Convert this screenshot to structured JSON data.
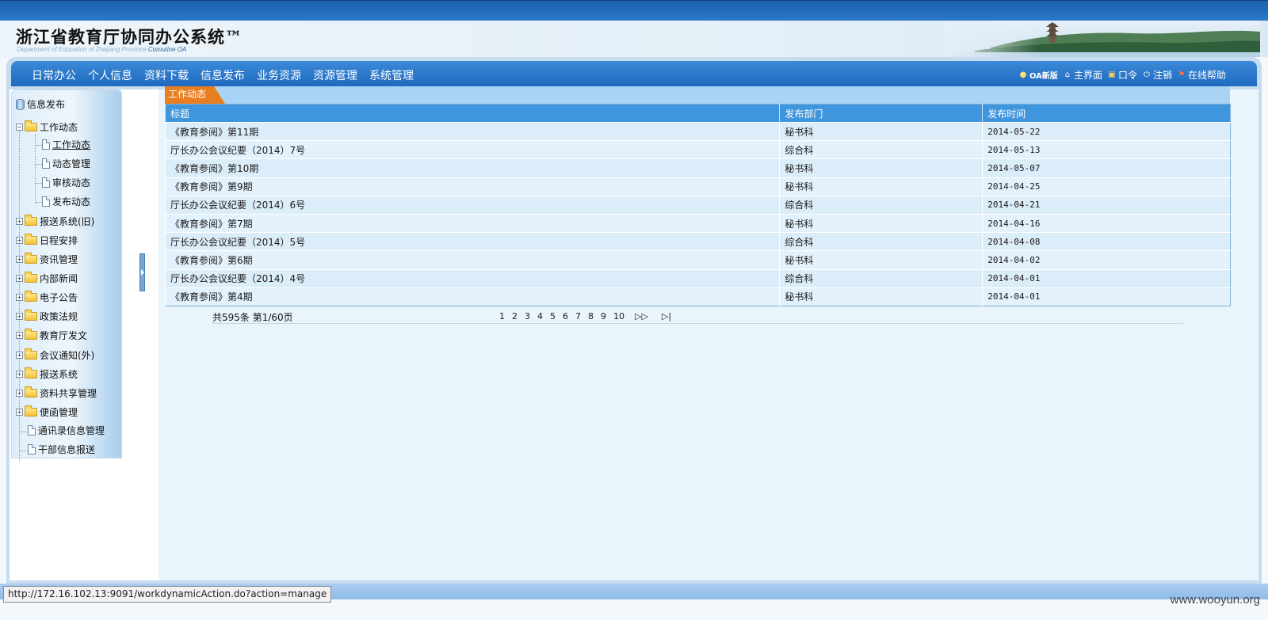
{
  "header": {
    "title": "浙江省教育厅协同办公系统™",
    "subtitle_pre": "Department of Education of Zhejiang Province",
    "subtitle_em": "Coroutine OA"
  },
  "nav": {
    "menu": [
      "日常办公",
      "个人信息",
      "资料下载",
      "信息发布",
      "业务资源",
      "资源管理",
      "系统管理"
    ],
    "right": [
      {
        "label": "OA新版",
        "icon": "bulb-icon"
      },
      {
        "label": "主界面",
        "icon": "home-icon"
      },
      {
        "label": "口令",
        "icon": "key-icon"
      },
      {
        "label": "注销",
        "icon": "power-icon"
      },
      {
        "label": "在线帮助",
        "icon": "flag-icon"
      }
    ]
  },
  "sidebar": {
    "root": "信息发布",
    "work_folder": "工作动态",
    "work_children": [
      "工作动态",
      "动态管理",
      "审核动态",
      "发布动态"
    ],
    "folders": [
      "报送系统(旧)",
      "日程安排",
      "资讯管理",
      "内部新闻",
      "电子公告",
      "政策法规",
      "教育厅发文",
      "会议通知(外)",
      "报送系统",
      "资料共享管理",
      "便函管理"
    ],
    "docs": [
      "通讯录信息管理",
      "干部信息报送"
    ]
  },
  "tab": {
    "label": "工作动态"
  },
  "table": {
    "headers": [
      "标题",
      "发布部门",
      "发布时间"
    ],
    "rows": [
      [
        "《教育参阅》第11期",
        "秘书科",
        "2014-05-22"
      ],
      [
        "厅长办公会议纪要（2014）7号",
        "综合科",
        "2014-05-13"
      ],
      [
        "《教育参阅》第10期",
        "秘书科",
        "2014-05-07"
      ],
      [
        "《教育参阅》第9期",
        "秘书科",
        "2014-04-25"
      ],
      [
        "厅长办公会议纪要（2014）6号",
        "综合科",
        "2014-04-21"
      ],
      [
        "《教育参阅》第7期",
        "秘书科",
        "2014-04-16"
      ],
      [
        "厅长办公会议纪要（2014）5号",
        "综合科",
        "2014-04-08"
      ],
      [
        "《教育参阅》第6期",
        "秘书科",
        "2014-04-02"
      ],
      [
        "厅长办公会议纪要（2014）4号",
        "综合科",
        "2014-04-01"
      ],
      [
        "《教育参阅》第4期",
        "秘书科",
        "2014-04-01"
      ]
    ]
  },
  "pager": {
    "summary": "共595条 第1/60页",
    "pages": [
      "1",
      "2",
      "3",
      "4",
      "5",
      "6",
      "7",
      "8",
      "9",
      "10"
    ],
    "next": "▷▷",
    "last": "▷|"
  },
  "status": {
    "url": "http://172.16.102.13:9091/workdynamicAction.do?action=manage"
  },
  "watermark": "www.wooyun.org"
}
